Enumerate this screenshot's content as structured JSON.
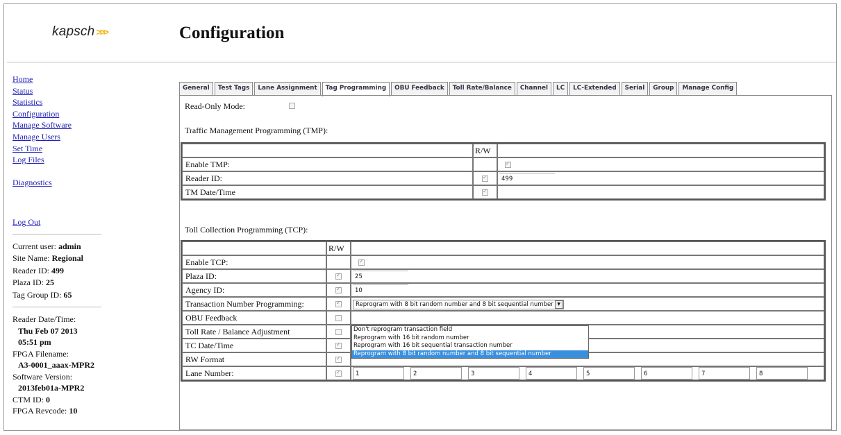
{
  "header": {
    "logo_text": "kapsch",
    "logo_arrows": ">>>",
    "title": "Configuration"
  },
  "nav": {
    "links": [
      "Home",
      "Status",
      "Statistics",
      "Configuration",
      "Manage Software",
      "Manage Users",
      "Set Time",
      "Log Files"
    ],
    "diagnostics": "Diagnostics",
    "logout": "Log Out"
  },
  "info": {
    "current_user_label": "Current user:",
    "current_user": "admin",
    "site_name_label": "Site Name:",
    "site_name": "Regional",
    "reader_id_label": "Reader ID:",
    "reader_id": "499",
    "plaza_id_label": "Plaza ID:",
    "plaza_id": "25",
    "tag_group_label": "Tag Group ID:",
    "tag_group": "65",
    "reader_dt_label": "Reader Date/Time:",
    "reader_date": "Thu Feb 07 2013",
    "reader_time": "05:51 pm",
    "fpga_file_label": "FPGA Filename:",
    "fpga_file": "A3-0001_aaax-MPR2",
    "sw_version_label": "Software Version:",
    "sw_version": "2013feb01a-MPR2",
    "ctm_id_label": "CTM ID:",
    "ctm_id": "0",
    "fpga_revcode_label": "FPGA Revcode:",
    "fpga_revcode": "10"
  },
  "tabs": [
    "General",
    "Test Tags",
    "Lane Assignment",
    "Tag Programming",
    "OBU Feedback",
    "Toll Rate/Balance",
    "Channel",
    "LC",
    "LC-Extended",
    "Serial",
    "Group",
    "Manage Config"
  ],
  "active_tab": "Tag Programming",
  "readonly": {
    "label": "Read-Only Mode:",
    "checked": false
  },
  "tmp": {
    "heading": "Traffic Management Programming (TMP):",
    "rw_header": "R/W",
    "rows": {
      "enable": {
        "label": "Enable TMP:",
        "checked": true
      },
      "reader_id": {
        "label": "Reader ID:",
        "rw": true,
        "value": "499"
      },
      "datetime": {
        "label": "TM Date/Time",
        "rw": true
      }
    }
  },
  "tcp": {
    "heading": "Toll Collection Programming (TCP):",
    "rw_header": "R/W",
    "rows": {
      "enable": {
        "label": "Enable TCP:",
        "checked": true
      },
      "plaza": {
        "label": "Plaza ID:",
        "rw": true,
        "value": "25"
      },
      "agency": {
        "label": "Agency ID:",
        "rw": true,
        "value": "10"
      },
      "txn": {
        "label": "Transaction Number Programming:",
        "rw": true,
        "selected": "Reprogram with 8 bit random number and 8 bit sequential number"
      },
      "obu": {
        "label": "OBU Feedback",
        "rw": false
      },
      "toll": {
        "label": "Toll Rate / Balance Adjustment",
        "rw": false
      },
      "tc_dt": {
        "label": "TC Date/Time",
        "rw": true
      },
      "rw_format": {
        "label": "RW Format",
        "rw": true
      },
      "lane": {
        "label": "Lane Number:",
        "rw": true,
        "values": [
          "1",
          "2",
          "3",
          "4",
          "5",
          "6",
          "7",
          "8"
        ]
      }
    },
    "txn_options": [
      "Don't reprogram transaction field",
      "Reprogram with 16 bit random number",
      "Reprogram with 16 bit sequential transaction number",
      "Reprogram with 8 bit random number and 8 bit sequential number"
    ]
  }
}
